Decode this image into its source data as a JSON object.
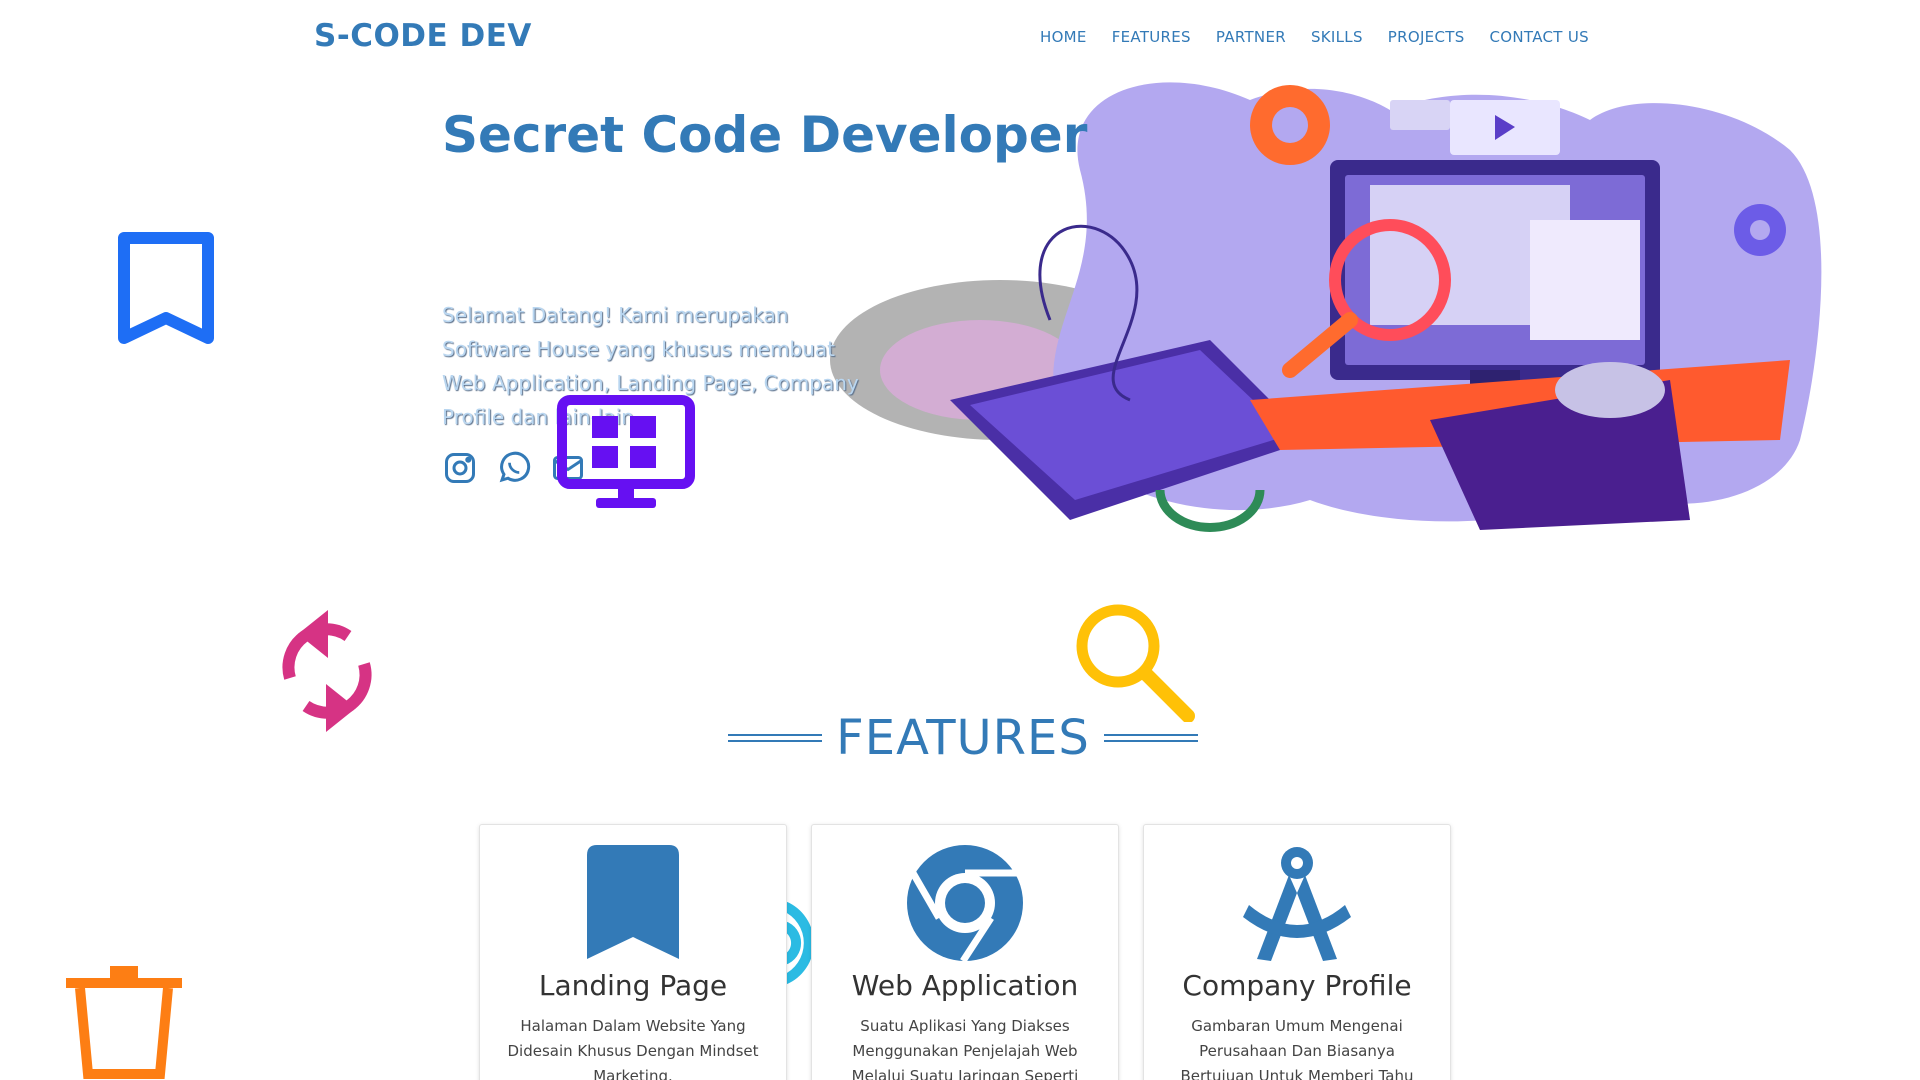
{
  "header": {
    "brand": "S-CODE DEV",
    "nav": [
      "HOME",
      "FEATURES",
      "PARTNER",
      "SKILLS",
      "PROJECTS",
      "CONTACT US"
    ]
  },
  "hero": {
    "title": "Secret Code Developer",
    "text": "Selamat Datang! Kami merupakan Software House yang khusus membuat Web Application, Landing Page, Company Profile dan lain-lain.",
    "socials": [
      "instagram-icon",
      "whatsapp-icon",
      "email-icon"
    ]
  },
  "features": {
    "heading": "FEATURES",
    "cards": [
      {
        "icon": "bookmark-icon",
        "title": "Landing Page",
        "desc": "Halaman Dalam Website Yang Didesain Khusus Dengan Mindset Marketing."
      },
      {
        "icon": "chrome-icon",
        "title": "Web Application",
        "desc": "Suatu Aplikasi Yang Diakses Menggunakan Penjelajah Web Melalui Suatu Jaringan Seperti Internet Atau"
      },
      {
        "icon": "compass-icon",
        "title": "Company Profile",
        "desc": "Gambaran Umum Mengenai Perusahaan Dan Biasanya Bertujuan Untuk Memberi Tahu Kepada Audiens"
      }
    ]
  },
  "colors": {
    "primary": "#337ab7",
    "bookmark_float": "#1e6ef5",
    "refresh_float": "#d63384",
    "search_float": "#ffc107",
    "trash_float": "#fd7e14",
    "monitor_float": "#6610f2"
  }
}
